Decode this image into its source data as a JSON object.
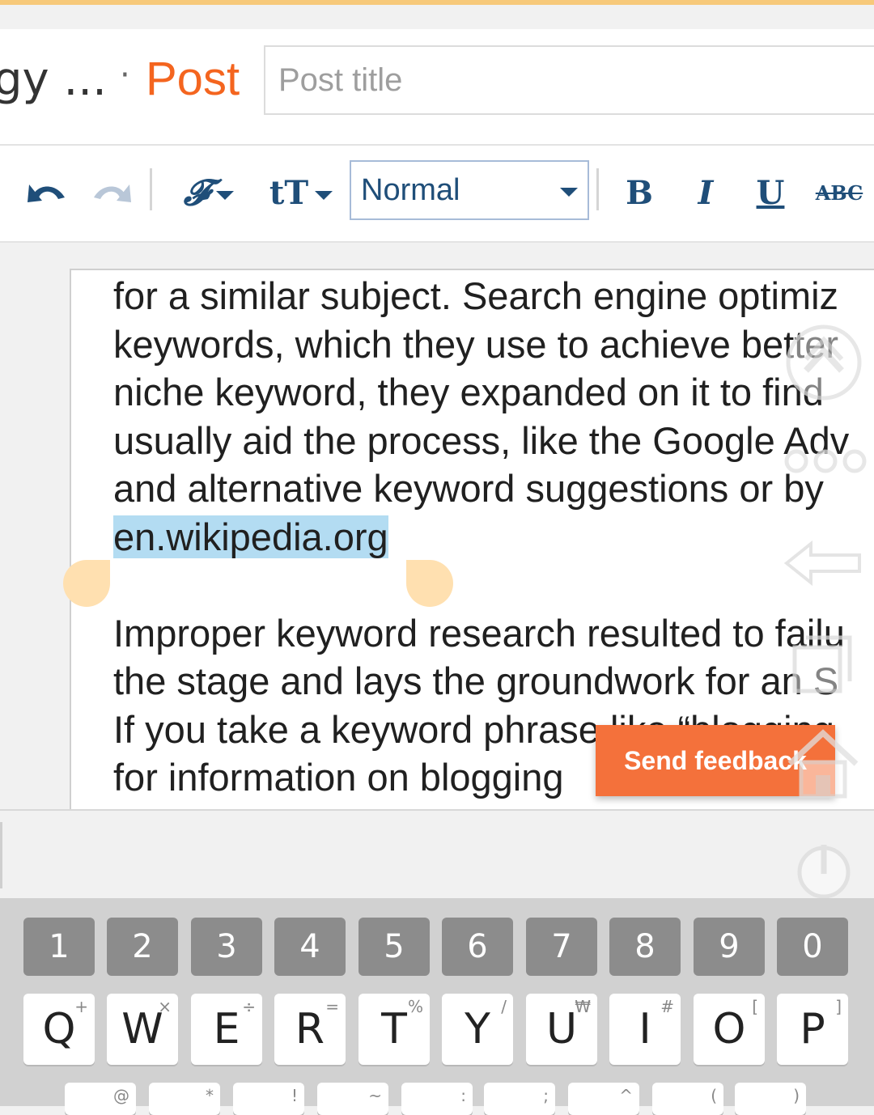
{
  "header": {
    "blog_name": "gy ...",
    "separator": "·",
    "post_label": "Post",
    "title_placeholder": "Post title",
    "title_value": ""
  },
  "toolbar": {
    "format_value": "Normal",
    "bold": "B",
    "italic": "I",
    "underline": "U",
    "strike": "ABC",
    "font_icon": "𝓕",
    "size_icon": "tT"
  },
  "editor": {
    "lines": [
      "for a similar subject. Search engine optimiz",
      "keywords, which they use to achieve better",
      "niche keyword, they expanded on it to find",
      "usually aid the process, like the Google Adv",
      "and alternative keyword suggestions or by",
      "en.wikipedia.org",
      "",
      "Improper keyword research resulted to failu",
      "the stage and lays the groundwork for an S",
      "If  you take a keyword phrase like “blogging",
      "for information on blogging"
    ],
    "selected_text": "en.wikipedia.org"
  },
  "feedback": {
    "label": "Send feedback"
  },
  "keyboard": {
    "numbers": [
      "1",
      "2",
      "3",
      "4",
      "5",
      "6",
      "7",
      "8",
      "9",
      "0"
    ],
    "letters": [
      {
        "key": "Q",
        "sub": "+"
      },
      {
        "key": "W",
        "sub": "×"
      },
      {
        "key": "E",
        "sub": "÷"
      },
      {
        "key": "R",
        "sub": "="
      },
      {
        "key": "T",
        "sub": "%"
      },
      {
        "key": "Y",
        "sub": "/"
      },
      {
        "key": "U",
        "sub": "₩"
      },
      {
        "key": "I",
        "sub": "#"
      },
      {
        "key": "O",
        "sub": "["
      },
      {
        "key": "P",
        "sub": "]"
      }
    ],
    "row3_subs": [
      "@",
      "*",
      "!",
      "~",
      ":",
      ";",
      "^",
      "(",
      ")"
    ]
  },
  "colors": {
    "accent": "#f4651f",
    "feedback": "#f4713b",
    "selection": "#b3dcf2",
    "handle": "#ffe0b0",
    "toolbar_icon": "#1f4e79"
  },
  "icons": [
    "undo-icon",
    "redo-icon",
    "font-family-icon",
    "font-size-icon",
    "bold-icon",
    "italic-icon",
    "underline-icon",
    "strikethrough-icon",
    "scroll-top-icon",
    "more-dots-icon",
    "back-arrow-icon",
    "recent-apps-icon",
    "home-icon",
    "power-icon"
  ]
}
